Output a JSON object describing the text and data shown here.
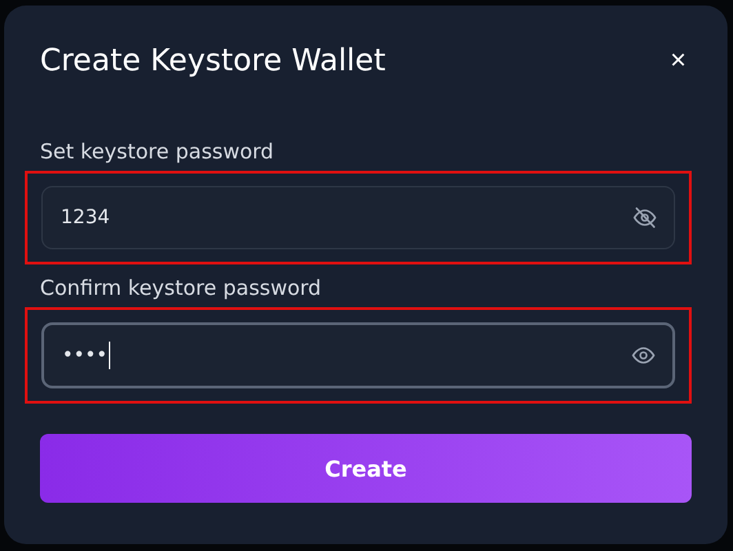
{
  "dialog": {
    "title": "Create Keystore Wallet",
    "close": "×"
  },
  "fields": [
    {
      "label": "Set keystore password",
      "value": "1234",
      "revealed": true,
      "focused": false,
      "highlighted": true
    },
    {
      "label": "Confirm keystore password",
      "value": "••••",
      "revealed": false,
      "focused": true,
      "highlighted": true
    }
  ],
  "button": "Create"
}
